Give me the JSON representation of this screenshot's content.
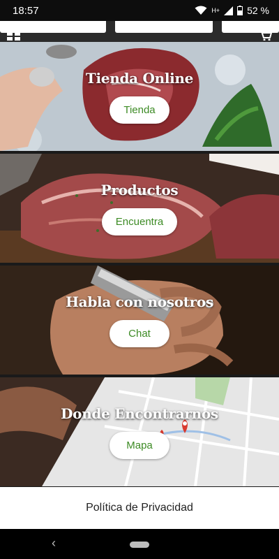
{
  "status_bar": {
    "time": "18:57",
    "network": "H+",
    "battery": "52 %"
  },
  "tiles": [
    {
      "title": "Tienda Online",
      "button": "Tienda"
    },
    {
      "title": "Productos",
      "button": "Encuentra"
    },
    {
      "title": "Habla con nosotros",
      "button": "Chat"
    },
    {
      "title": "Donde Encontrarnos",
      "button": "Mapa"
    }
  ],
  "footer": {
    "privacy_label": "Política de Privacidad"
  },
  "icons": {
    "wifi": "wifi-icon",
    "signal": "signal-icon",
    "battery": "battery-icon",
    "menu": "grid-menu-icon",
    "cart": "cart-icon",
    "back": "back-icon",
    "home": "home-pill-icon"
  },
  "colors": {
    "button_text": "#3d8b25",
    "button_bg": "#ffffff"
  }
}
